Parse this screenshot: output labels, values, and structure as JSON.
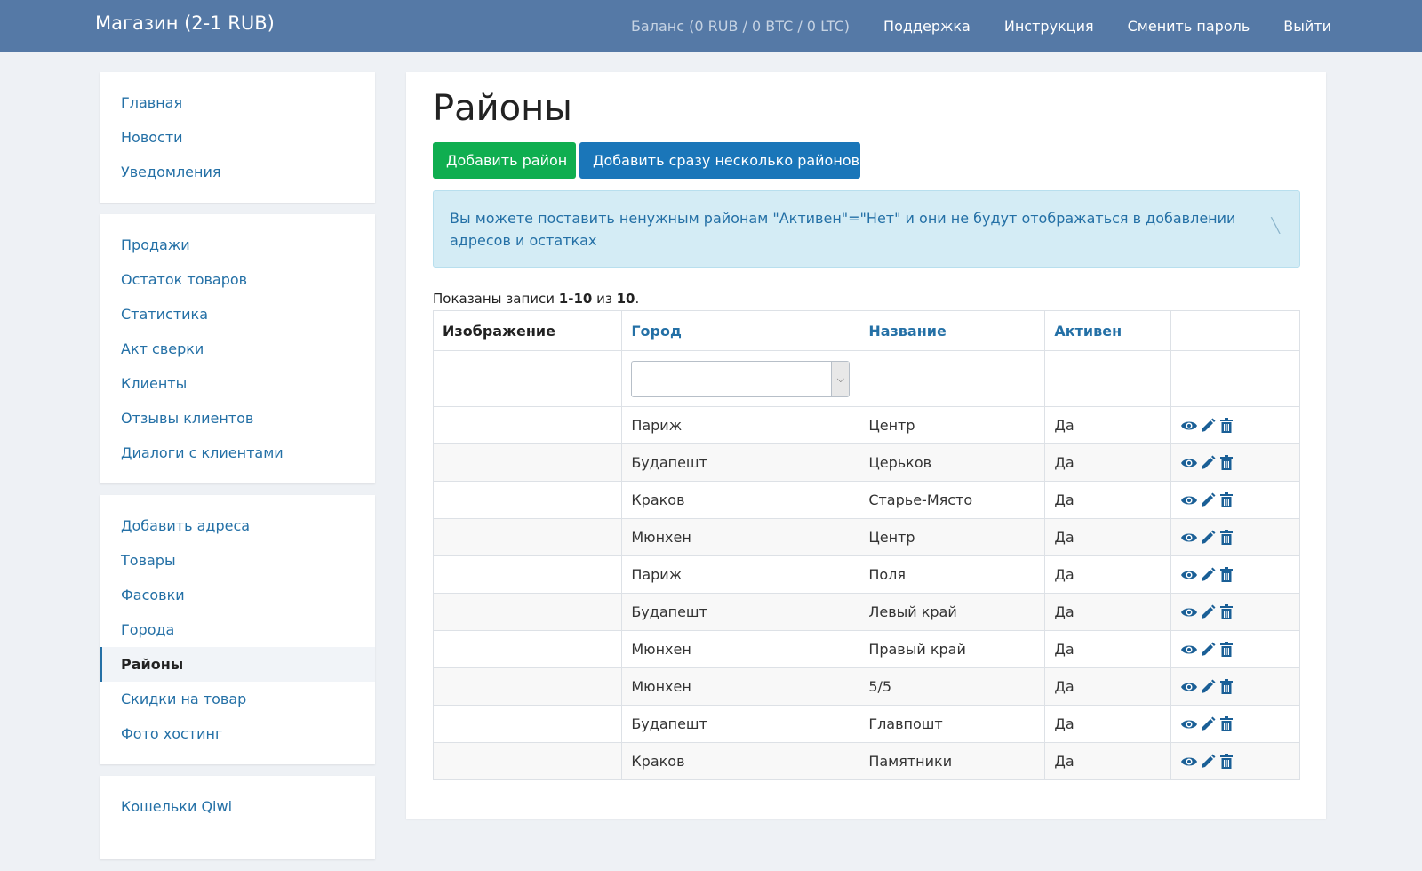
{
  "header": {
    "brand": "Магазин (2-1 RUB)",
    "balance": "Баланс (0 RUB / 0 BTC / 0 LTC)",
    "nav": [
      "Поддержка",
      "Инструкция",
      "Сменить пароль",
      "Выйти"
    ]
  },
  "sidebar": {
    "panel1": [
      "Главная",
      "Новости",
      "Уведомления"
    ],
    "panel2": [
      "Продажи",
      "Остаток товаров",
      "Статистика",
      "Акт сверки",
      "Клиенты",
      "Отзывы клиентов",
      "Диалоги с клиентами"
    ],
    "panel3": [
      "Добавить адреса",
      "Товары",
      "Фасовки",
      "Города",
      "Районы",
      "Скидки на товар",
      "Фото хостинг"
    ],
    "panel4": [
      "Кошельки Qiwi"
    ],
    "active": "Районы"
  },
  "main": {
    "title": "Районы",
    "add_button": "Добавить район",
    "add_multi_button": "Добавить сразу несколько районов",
    "alert": "Вы можете поставить ненужным районам \"Активен\"=\"Нет\" и они не будут отображаться в добавлении адресов и остатках",
    "summary": {
      "prefix": "Показаны записи ",
      "range": "1-10",
      "middle": " из ",
      "total": "10",
      "suffix": "."
    },
    "columns": [
      "Изображение",
      "Город",
      "Название",
      "Активен",
      ""
    ],
    "city_filter_value": "",
    "rows": [
      {
        "city": "Париж",
        "name": "Центр",
        "active": "Да"
      },
      {
        "city": "Будапешт",
        "name": "Церьков",
        "active": "Да"
      },
      {
        "city": "Краков",
        "name": "Старье-Място",
        "active": "Да"
      },
      {
        "city": "Мюнхен",
        "name": "Центр",
        "active": "Да"
      },
      {
        "city": "Париж",
        "name": "Поля",
        "active": "Да"
      },
      {
        "city": "Будапешт",
        "name": "Левый край",
        "active": "Да"
      },
      {
        "city": "Мюнхен",
        "name": "Правый край",
        "active": "Да"
      },
      {
        "city": "Мюнхен",
        "name": "5/5",
        "active": "Да"
      },
      {
        "city": "Будапешт",
        "name": "Главпошт",
        "active": "Да"
      },
      {
        "city": "Краков",
        "name": "Памятники",
        "active": "Да"
      }
    ]
  },
  "icons": {
    "view": "eye-icon",
    "edit": "pencil-icon",
    "delete": "trash-icon"
  },
  "colors": {
    "header_bg": "#5579a6",
    "link": "#2470a6",
    "add_button": "#0fae50",
    "multi_button": "#1a76b9",
    "alert_bg": "#d4ecf5"
  }
}
